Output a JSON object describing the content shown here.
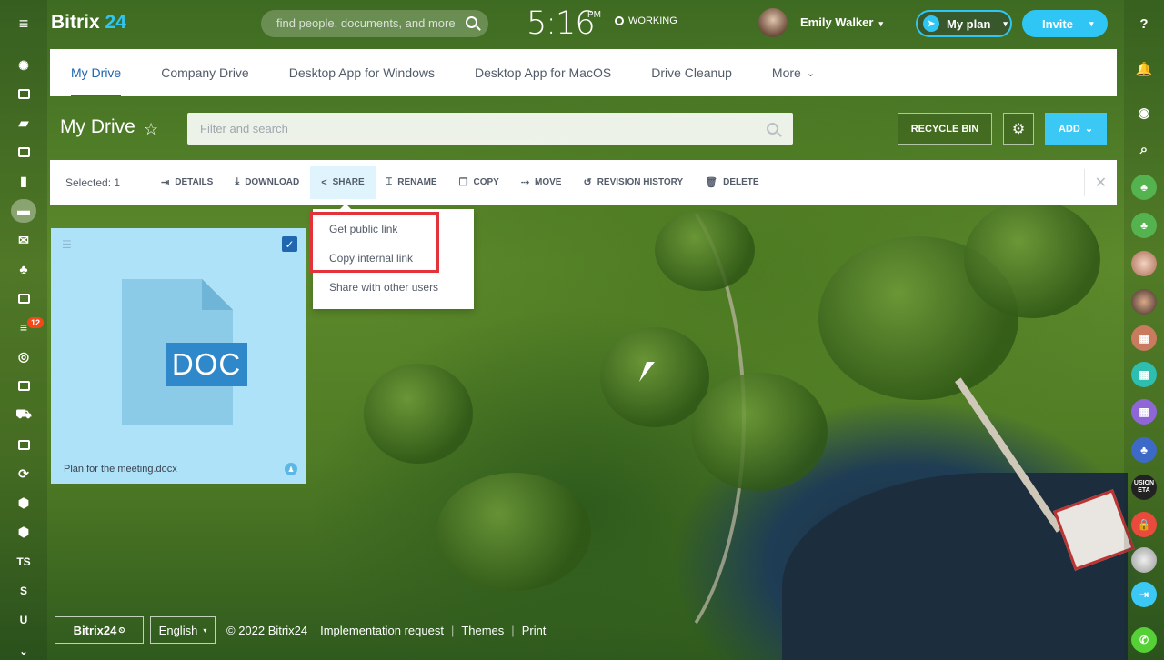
{
  "header": {
    "logo_main": "Bitrix",
    "logo_num": "24",
    "search_placeholder": "find people, documents, and more",
    "clock": "5:16",
    "ampm": "PM",
    "status": "WORKING",
    "user_name": "Emily Walker",
    "plan_label": "My plan",
    "invite_label": "Invite"
  },
  "tabs": [
    "My Drive",
    "Company Drive",
    "Desktop App for Windows",
    "Desktop App for MacOS",
    "Drive Cleanup",
    "More"
  ],
  "toolbar": {
    "title": "My Drive",
    "filter_placeholder": "Filter and search",
    "recycle_bin": "RECYCLE BIN",
    "add": "ADD"
  },
  "actionbar": {
    "selected": "Selected: 1",
    "actions": [
      "DETAILS",
      "DOWNLOAD",
      "SHARE",
      "RENAME",
      "COPY",
      "MOVE",
      "REVISION HISTORY",
      "DELETE"
    ]
  },
  "share_menu": [
    "Get public link",
    "Copy internal link",
    "Share with other users"
  ],
  "file": {
    "type_label": "DOC",
    "name": "Plan for the meeting.docx"
  },
  "left_rail": {
    "badge": "12",
    "letters": [
      "TS",
      "S",
      "U"
    ]
  },
  "right_rail": {
    "help": "?",
    "tag_text": "USION ETA"
  },
  "footer": {
    "logo": "Bitrix24",
    "language": "English",
    "copyright": "© 2022 Bitrix24",
    "links": [
      "Implementation request",
      "Themes",
      "Print"
    ]
  },
  "colors": {
    "accent": "#2fc6f6",
    "tab_active": "#2067b0",
    "highlight_box": "#e4323a",
    "tile_bg": "#aee2f9"
  }
}
